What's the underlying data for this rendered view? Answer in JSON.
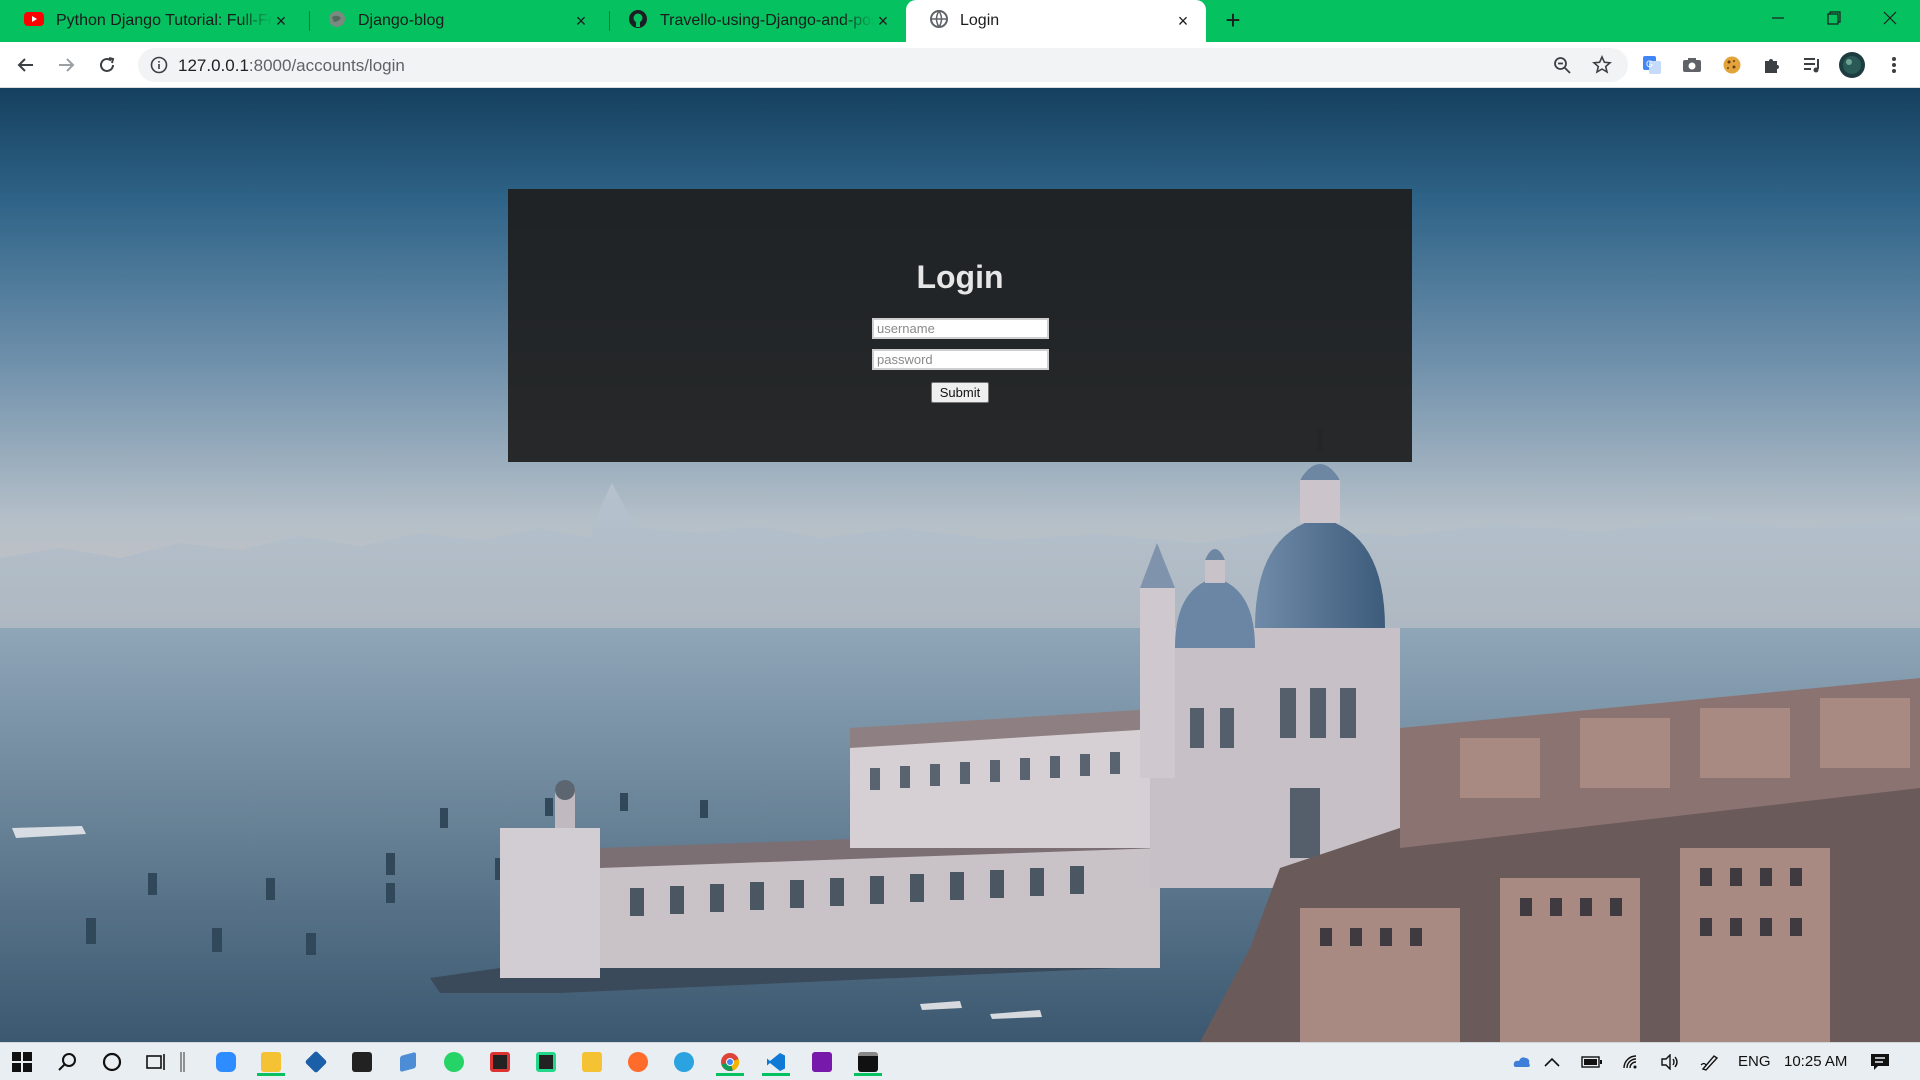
{
  "browser": {
    "tabs": [
      {
        "title": "Python Django Tutorial: Full-Featured Web App"
      },
      {
        "title": "Django-blog"
      },
      {
        "title": "Travello-using-Django-and-postgres"
      },
      {
        "title": "Login"
      }
    ],
    "url_host": "127.0.0.1",
    "url_path": ":8000/accounts/login"
  },
  "login": {
    "title": "Login",
    "username_placeholder": "username",
    "password_placeholder": "password",
    "submit_label": "Submit"
  },
  "taskbar": {
    "language": "ENG",
    "time": "10:25 AM"
  },
  "colors": {
    "tabstrip": "#05c160",
    "login_panel": "#1e1e1e"
  }
}
